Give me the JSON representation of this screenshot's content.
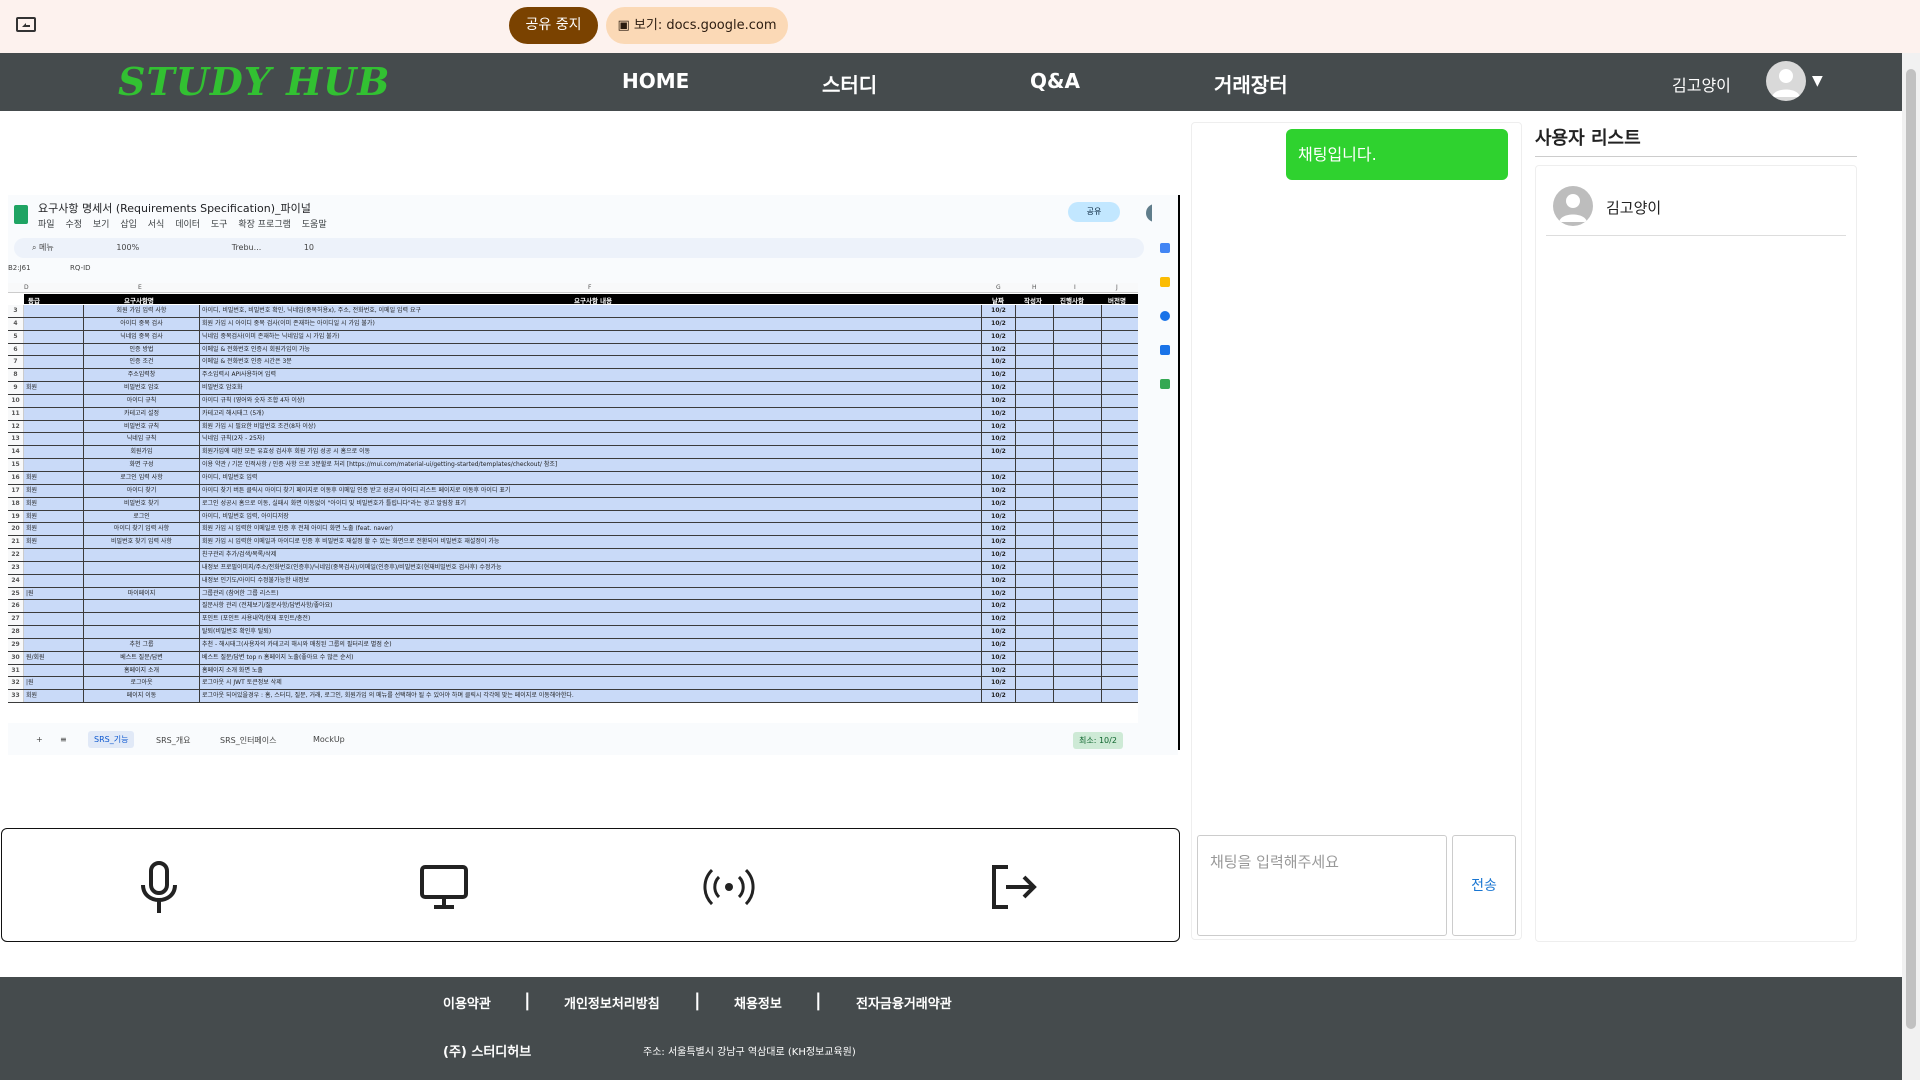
{
  "sharebar": {
    "stop_label": "공유 중지",
    "view_label": "보기: docs.google.com"
  },
  "navbar": {
    "logo": "STUDY HUB",
    "items": [
      "HOME",
      "스터디",
      "Q&A",
      "거래장터"
    ],
    "user_name": "김고양이"
  },
  "sheet": {
    "title": "요구사항 명세서 (Requirements Specification)_파이널",
    "menu": [
      "파일",
      "수정",
      "보기",
      "삽입",
      "서식",
      "데이터",
      "도구",
      "확장 프로그램",
      "도움말"
    ],
    "toolbar_search": "메뉴",
    "zoom": "100%",
    "font": "Trebu...",
    "font_size": "10",
    "cell_ref": "B2:J61",
    "formula": "RQ-ID",
    "share_label": "공유",
    "col_letters": [
      "D",
      "E",
      "F",
      "G",
      "H",
      "I",
      "J"
    ],
    "headers": [
      "등급",
      "요구사항명",
      "요구사항 내용",
      "날짜",
      "작성자",
      "진행사항",
      "버전명"
    ],
    "rows": [
      {
        "n": "3",
        "d": "",
        "e": "회원 가입 입력 사항",
        "f": "아이디, 비밀번호, 비밀번호 확인, 닉네임(중복허용x), 주소, 전화번호, 이메일 입력 요구",
        "g": "10/2"
      },
      {
        "n": "4",
        "d": "",
        "e": "아이디 중복 검사",
        "f": "회원 가입 시 아이디 중복 검사(이미 존재하는 아이디일 시 가입 불가)",
        "g": "10/2"
      },
      {
        "n": "5",
        "d": "",
        "e": "닉네임 중복 검사",
        "f": "닉네임 중복검사(이미 존재하는 닉네임일 시 가입 불가)",
        "g": "10/2"
      },
      {
        "n": "6",
        "d": "",
        "e": "인증 방법",
        "f": "이메일 & 전화번호 인증시 회원가입이 가능",
        "g": "10/2"
      },
      {
        "n": "7",
        "d": "",
        "e": "인증 조건",
        "f": "이메일 & 전화번호 인증 시간은 3분",
        "g": "10/2"
      },
      {
        "n": "8",
        "d": "",
        "e": "주소입력창",
        "f": "주소입력시 API사용하여 입력",
        "g": "10/2"
      },
      {
        "n": "9",
        "d": "회원",
        "e": "비밀번호 암호",
        "f": "비밀번호 암호화",
        "g": "10/2"
      },
      {
        "n": "10",
        "d": "",
        "e": "아이디 규칙",
        "f": "아이디 규칙 (영어와 숫자 조합 4자 이상)",
        "g": "10/2"
      },
      {
        "n": "11",
        "d": "",
        "e": "카테고리 설정",
        "f": "카테고리 해시태그 (5개)",
        "g": "10/2"
      },
      {
        "n": "12",
        "d": "",
        "e": "비밀번호 규칙",
        "f": "회원 가입 시 필요한 비밀번호 조건(8자 이상)",
        "g": "10/2"
      },
      {
        "n": "13",
        "d": "",
        "e": "닉네임 규칙",
        "f": "닉네임 규칙(2자 - 25자)",
        "g": "10/2"
      },
      {
        "n": "14",
        "d": "",
        "e": "회원가입",
        "f": "회원가입에 대한 모든 유효성 검사후 회원 가입 성공 시 홈으로 이동",
        "g": "10/2"
      },
      {
        "n": "15",
        "d": "",
        "e": "화면 구성",
        "f": "이용 약관 / 기본 인적사항 / 인증 사항 으로 3분할로 처리 [https://mui.com/material-ui/getting-started/templates/checkout/ 참조]",
        "g": ""
      },
      {
        "n": "16",
        "d": "회원",
        "e": "로그인 입력 사항",
        "f": "아이디, 비밀번호 입력",
        "g": "10/2"
      },
      {
        "n": "17",
        "d": "회원",
        "e": "아이디 찾기",
        "f": "아이디 찾기 버튼 클릭시 아이디 찾기 페이지로 이동후 이메일 인증 받고 성공시 아이디 리스트 페이지로 이동후 아이디 표기",
        "g": "10/2"
      },
      {
        "n": "18",
        "d": "회원",
        "e": "비밀번호 찾기",
        "f": "로그인 성공시 홈으로 이동, 실패시 화면 이동없이 \"아이디 및 비밀번호가 틀립니다\"라는 경고 알림창 표기",
        "g": "10/2"
      },
      {
        "n": "19",
        "d": "회원",
        "e": "로그인",
        "f": "아이디, 비밀번호 입력, 아이디저장",
        "g": "10/2"
      },
      {
        "n": "20",
        "d": "회원",
        "e": "아이디 찾기 입력 사항",
        "f": "회원 가입 시 입력한 이메일로 인증 후 전체 아이디 화면 노출 (feat. naver)",
        "g": "10/2"
      },
      {
        "n": "21",
        "d": "회원",
        "e": "비밀번호 찾기 입력 사항",
        "f": "회원 가입 시 입력한 이메일과 아이디로 인증 후 비밀번호 재설정 할 수 있는 화면으로 전환되어 비밀번호 재설정이 가능",
        "g": "10/2"
      },
      {
        "n": "22",
        "d": "",
        "e": "",
        "f": "친구관리 추가/검색/목록/삭제",
        "g": "10/2"
      },
      {
        "n": "23",
        "d": "",
        "e": "",
        "f": "내정보 프로필이미지/주소/전화번호(인증후)/닉네임(중복검사)/이메일(인증후)/비밀번호(현재비밀번호 검사후) 수정가능",
        "g": "10/2"
      },
      {
        "n": "24",
        "d": "",
        "e": "",
        "f": "내정보 인기도/아이디 수정불가능한 내정보",
        "g": "10/2"
      },
      {
        "n": "25",
        "d": "|원",
        "e": "마이페이지",
        "f": "그룹관리 (참여한 그룹 리스트)",
        "g": "10/2"
      },
      {
        "n": "26",
        "d": "",
        "e": "",
        "f": "질문사항 관리 (전체보기/질문사항/답변사항/좋아요)",
        "g": "10/2"
      },
      {
        "n": "27",
        "d": "",
        "e": "",
        "f": "포인트 (포인트 사용내역/현재 포인트/충전)",
        "g": "10/2"
      },
      {
        "n": "28",
        "d": "",
        "e": "",
        "f": "탈퇴(비밀번호 확인후 탈퇴)",
        "g": "10/2"
      },
      {
        "n": "29",
        "d": "",
        "e": "추천 그룹",
        "f": "추천 - 해시태그(사용자의 카테고리 해시와 매칭된 그룹의 필터리로 별점 순)",
        "g": "10/2"
      },
      {
        "n": "30",
        "d": "원/회원",
        "e": "베스트 질문/답변",
        "f": "베스트 질문/답변 top n 홈페이지 노출(좋아요 수 많은 순서)",
        "g": "10/2"
      },
      {
        "n": "31",
        "d": "",
        "e": "홈페이지 소개",
        "f": "홈페이지 소개 화면 노출",
        "g": "10/2"
      },
      {
        "n": "32",
        "d": "|원",
        "e": "로그아웃",
        "f": "로그아웃 시 JWT 토큰정보 삭제",
        "g": "10/2"
      },
      {
        "n": "33",
        "d": "회원",
        "e": "페이지 이동",
        "f": "로그아웃 되어있을경우 : 홈, 스터디, 질문, 거래, 로그인, 회원가입 의 메뉴를 선택해야 될 수 있어야 하며 클릭시 각각에 맞는 페이지로 이동해야한다.",
        "g": "10/2"
      }
    ],
    "tabs": [
      "SRS_기능",
      "SRS_개요",
      "SRS_인터페이스",
      "MockUp"
    ],
    "sum_chip": "최소: 10/2"
  },
  "controls": {
    "items": [
      "microphone-icon",
      "monitor-icon",
      "broadcast-icon",
      "exit-icon"
    ]
  },
  "chat": {
    "message": "채팅입니다.",
    "input_placeholder": "채팅을 입력해주세요",
    "send_label": "전송"
  },
  "users": {
    "title": "사용자 리스트",
    "list": [
      "김고양이"
    ]
  },
  "footer": {
    "links": [
      "이용약관",
      "개인정보처리방침",
      "채용정보",
      "전자금융거래약관"
    ],
    "company": "(주) 스터디허브",
    "address": "주소: 서울특별시 강남구 역삼대로 (KH정보교육원)"
  },
  "colors": {
    "navbar": "#454b4d",
    "logo_green": "#32c132",
    "chat_bubble": "#2fd22f",
    "sheet_cell": "#c9daf8",
    "share_stop": "#7a4200"
  }
}
